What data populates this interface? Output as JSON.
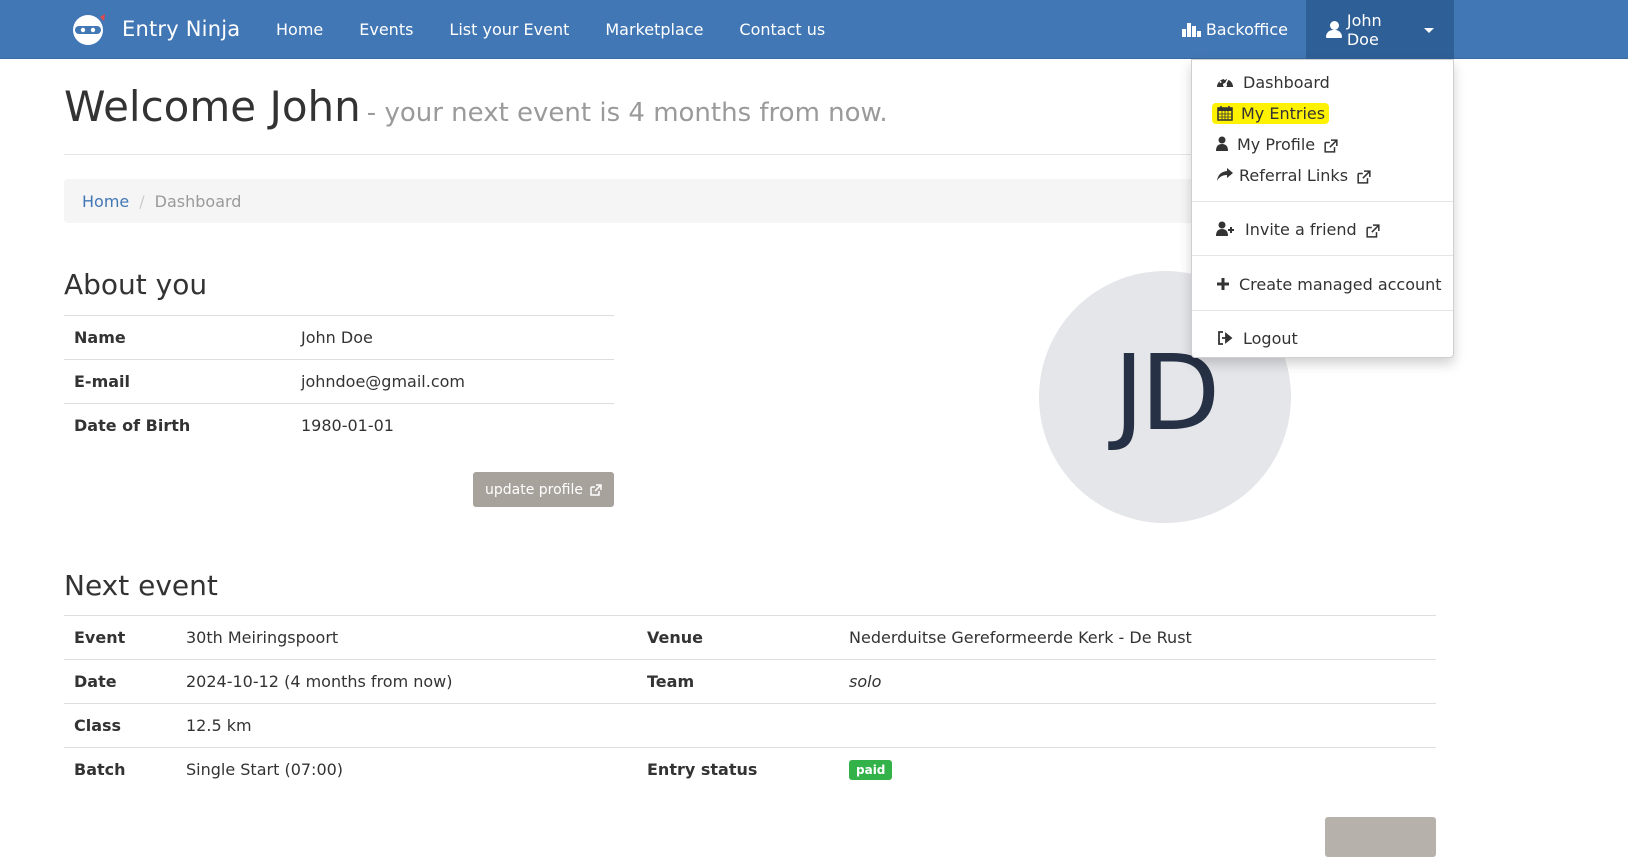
{
  "nav": {
    "brand": "Entry Ninja",
    "links": [
      "Home",
      "Events",
      "List your Event",
      "Marketplace",
      "Contact us"
    ],
    "backoffice": "Backoffice",
    "user": "John Doe"
  },
  "header": {
    "title": "Welcome John",
    "subtitle": "- your next event is 4 months from now."
  },
  "breadcrumb": {
    "home": "Home",
    "separator": "/",
    "current": "Dashboard"
  },
  "about": {
    "title": "About you",
    "rows": [
      {
        "label": "Name",
        "value": "John Doe"
      },
      {
        "label": "E-mail",
        "value": "johndoe@gmail.com"
      },
      {
        "label": "Date of Birth",
        "value": "1980-01-01"
      }
    ],
    "update_button": "update profile",
    "avatar_initials": "JD"
  },
  "next_event": {
    "title": "Next event",
    "event_label": "Event",
    "event_value": "30th Meiringspoort",
    "venue_label": "Venue",
    "venue_value": "Nederduitse Gereformeerde Kerk - De Rust",
    "date_label": "Date",
    "date_value": "2024-10-12 (4 months from now)",
    "team_label": "Team",
    "team_value": "solo",
    "class_label": "Class",
    "class_value": "12.5 km",
    "batch_label": "Batch",
    "batch_value": "Single Start (07:00)",
    "status_label": "Entry status",
    "status_value": "paid"
  },
  "dropdown": {
    "dashboard": "Dashboard",
    "my_entries": "My Entries",
    "my_profile": "My Profile",
    "referral_links": "Referral Links",
    "invite_friend": "Invite a friend",
    "create_managed": "Create managed account",
    "logout": "Logout"
  },
  "colors": {
    "navbar": "#4277b5",
    "user_menu_active": "#2f5f97",
    "highlight": "#fff200",
    "badge_paid": "#34b24a",
    "button": "#a8a29d"
  }
}
